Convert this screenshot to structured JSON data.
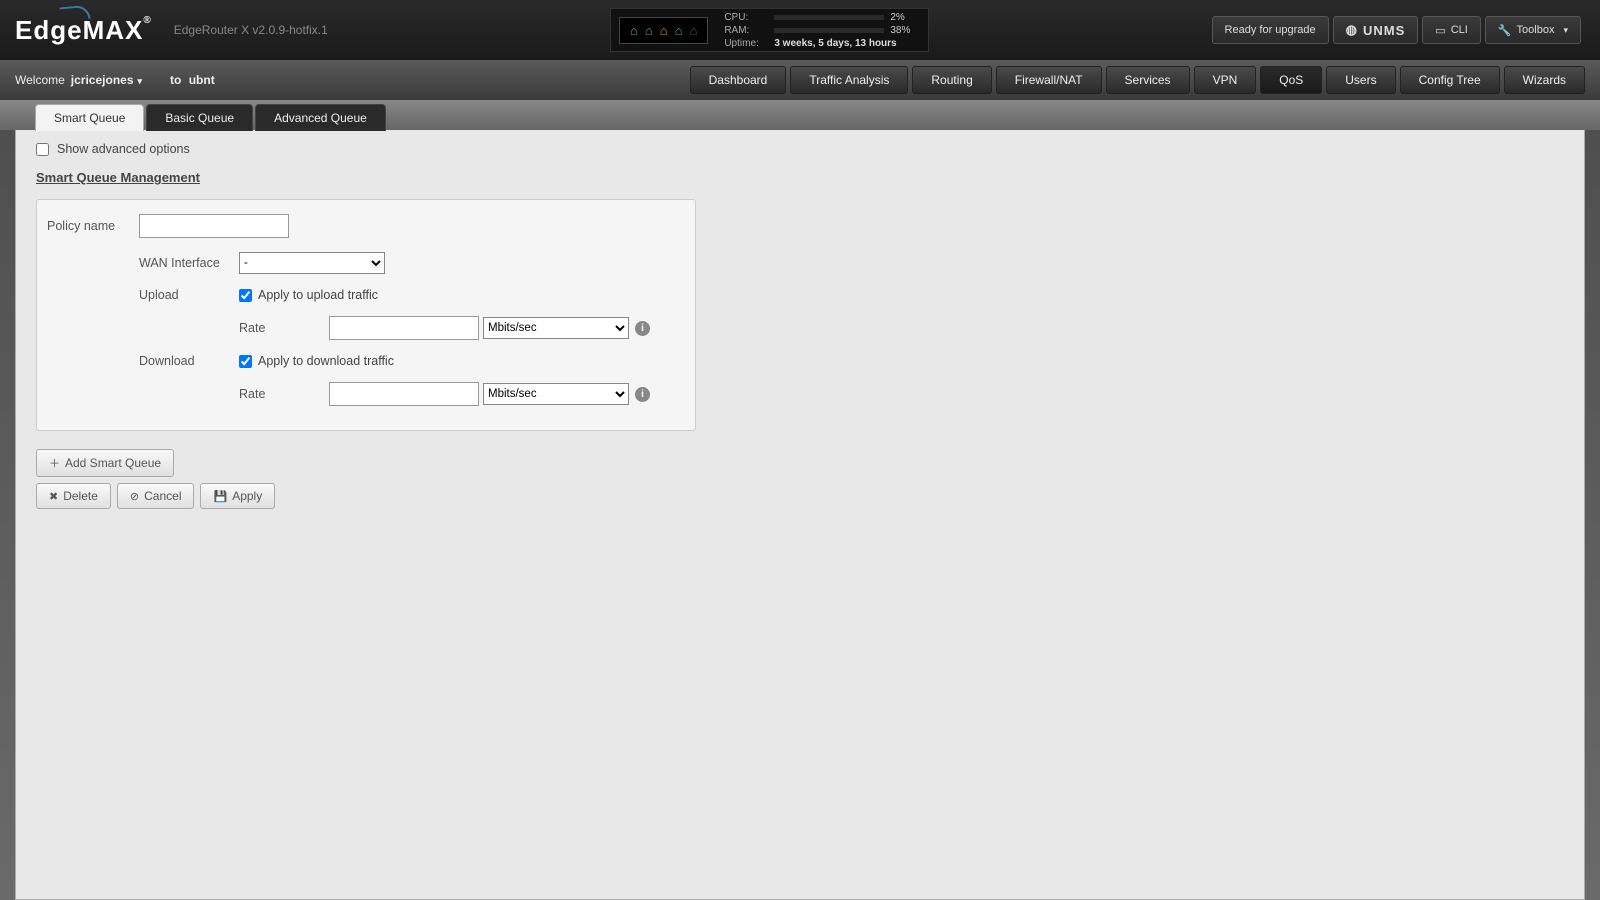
{
  "brand": {
    "logo": "EdgeMAX",
    "reg": "®",
    "product": "EdgeRouter X v2.0.9-hotfix.1"
  },
  "status": {
    "ports": [
      {
        "color": "green"
      },
      {
        "color": "green"
      },
      {
        "color": "orange"
      },
      {
        "color": "green"
      },
      {
        "color": "dim"
      }
    ],
    "cpu_label": "CPU:",
    "cpu_pct": "2%",
    "cpu_fill": 2,
    "ram_label": "RAM:",
    "ram_pct": "38%",
    "ram_fill": 38,
    "uptime_label": "Uptime:",
    "uptime_value": "3 weeks, 5 days, 13 hours"
  },
  "header_buttons": {
    "upgrade": "Ready for upgrade",
    "unms": "UNMS",
    "cli": "CLI",
    "toolbox": "Toolbox"
  },
  "welcome": {
    "prefix": "Welcome",
    "user": "jcricejones",
    "to": "to",
    "host": "ubnt"
  },
  "nav": [
    "Dashboard",
    "Traffic Analysis",
    "Routing",
    "Firewall/NAT",
    "Services",
    "VPN",
    "QoS",
    "Users",
    "Config Tree",
    "Wizards"
  ],
  "nav_active_index": 6,
  "subtabs": [
    "Smart Queue",
    "Basic Queue",
    "Advanced Queue"
  ],
  "subtab_active_index": 0,
  "page": {
    "show_advanced": "Show advanced options",
    "section_title": "Smart Queue Management",
    "policy_name_label": "Policy name",
    "wan_label": "WAN Interface",
    "wan_selected": "-",
    "upload_label": "Upload",
    "apply_upload": "Apply to upload traffic",
    "download_label": "Download",
    "apply_download": "Apply to download traffic",
    "rate_label": "Rate",
    "unit_selected": "Mbits/sec",
    "add_btn": "Add Smart Queue",
    "delete_btn": "Delete",
    "cancel_btn": "Cancel",
    "apply_btn": "Apply"
  }
}
